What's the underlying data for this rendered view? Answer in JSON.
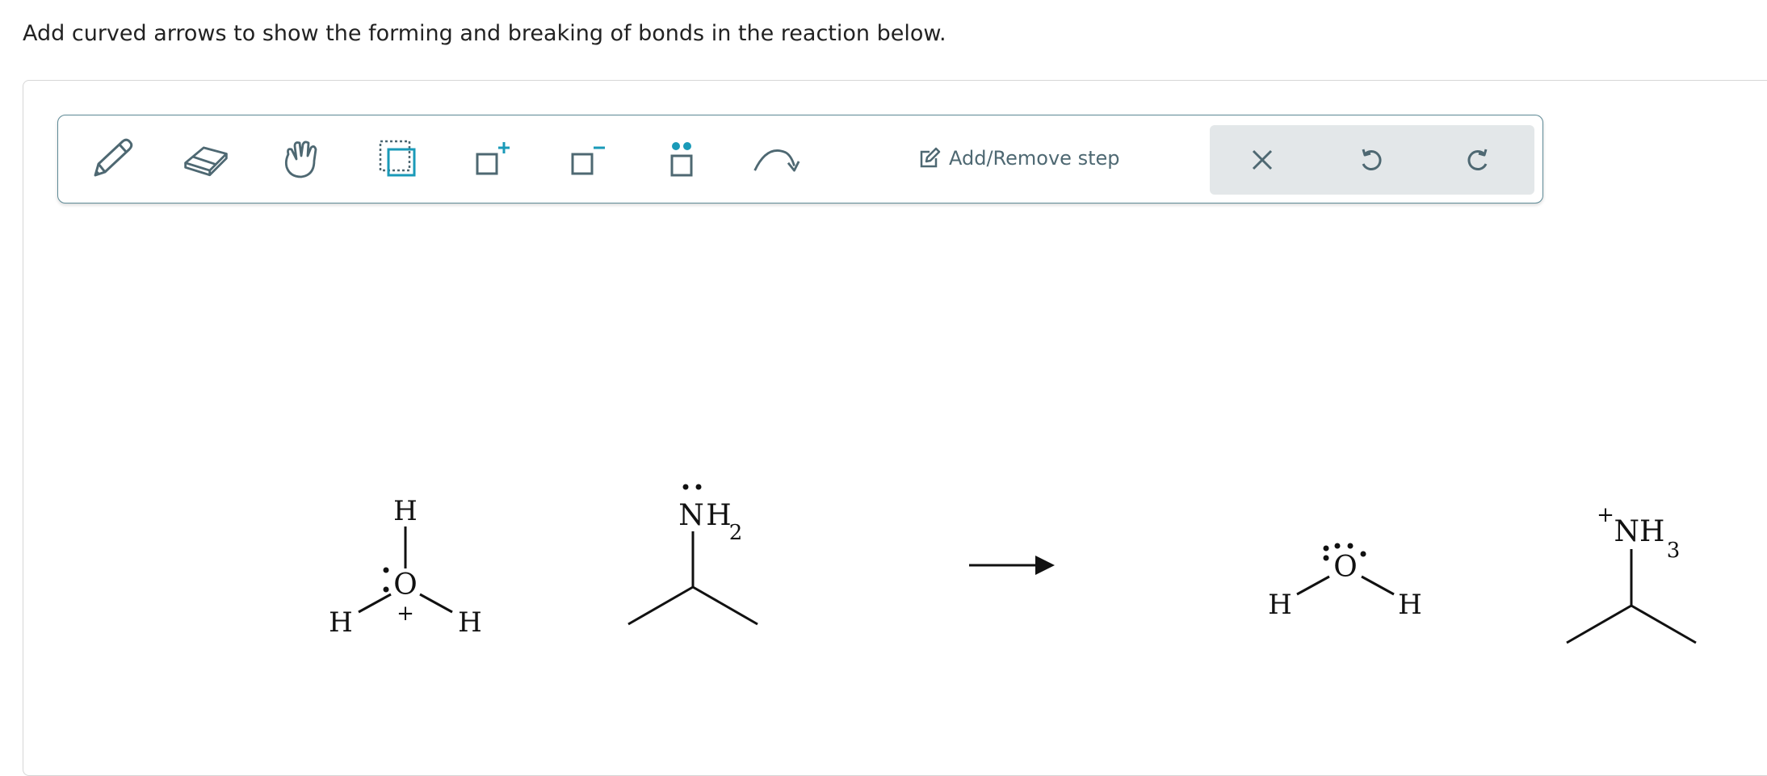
{
  "prompt": "Add curved arrows to show the forming and breaking of bonds in the reaction below.",
  "toolbar": {
    "tools": [
      {
        "name": "pencil",
        "icon": "pencil-icon"
      },
      {
        "name": "eraser",
        "icon": "eraser-icon"
      },
      {
        "name": "hand",
        "icon": "hand-icon"
      },
      {
        "name": "select",
        "icon": "select-box-icon"
      },
      {
        "name": "add-charge",
        "icon": "positive-charge-icon",
        "symbol": "+"
      },
      {
        "name": "remove-charge",
        "icon": "negative-charge-icon",
        "symbol": "−"
      },
      {
        "name": "lone-pair",
        "icon": "lone-pair-icon"
      },
      {
        "name": "curved-arrow",
        "icon": "curved-arrow-icon"
      }
    ],
    "add_remove_step_label": "Add/Remove step",
    "actions": {
      "clear_icon": "close-icon",
      "undo_icon": "undo-icon",
      "redo_icon": "redo-icon"
    }
  },
  "colors": {
    "accent": "#1a9ab8",
    "icon": "#4e6872",
    "toolbar_border": "#5e8a96",
    "action_bg": "#e3e7e9"
  },
  "reaction": {
    "reactant1": {
      "center": "O",
      "h_top": "H",
      "h_left": "H",
      "h_right": "H",
      "charge": "+"
    },
    "reactant2": {
      "group": "N",
      "group_h": "H",
      "group_sub": "2"
    },
    "product1": {
      "center": "O",
      "h_left": "H",
      "h_right": "H"
    },
    "product2": {
      "group": "NH",
      "group_sub": "3",
      "charge": "+"
    }
  }
}
